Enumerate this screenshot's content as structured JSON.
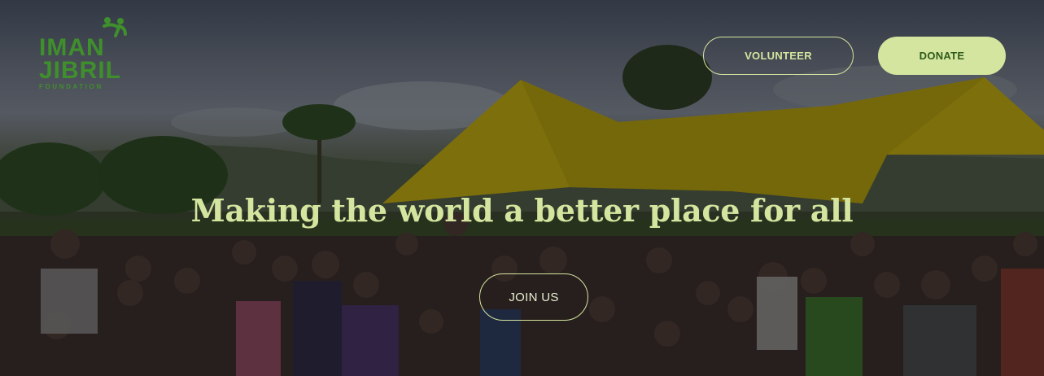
{
  "logo": {
    "line1": "IMAN",
    "line2": "JIBRIL",
    "sub": "FOUNDATION",
    "icon": "people-figure-icon"
  },
  "nav": {
    "volunteer_label": "VOLUNTEER",
    "donate_label": "DONATE"
  },
  "hero": {
    "headline": "Making the world a better place for all",
    "join_label": "JOIN US"
  },
  "colors": {
    "accent": "#d4e59f",
    "brand_green": "#3f8f2c",
    "donate_text": "#2f5a1c",
    "tent_yellow": "#c9b515"
  }
}
